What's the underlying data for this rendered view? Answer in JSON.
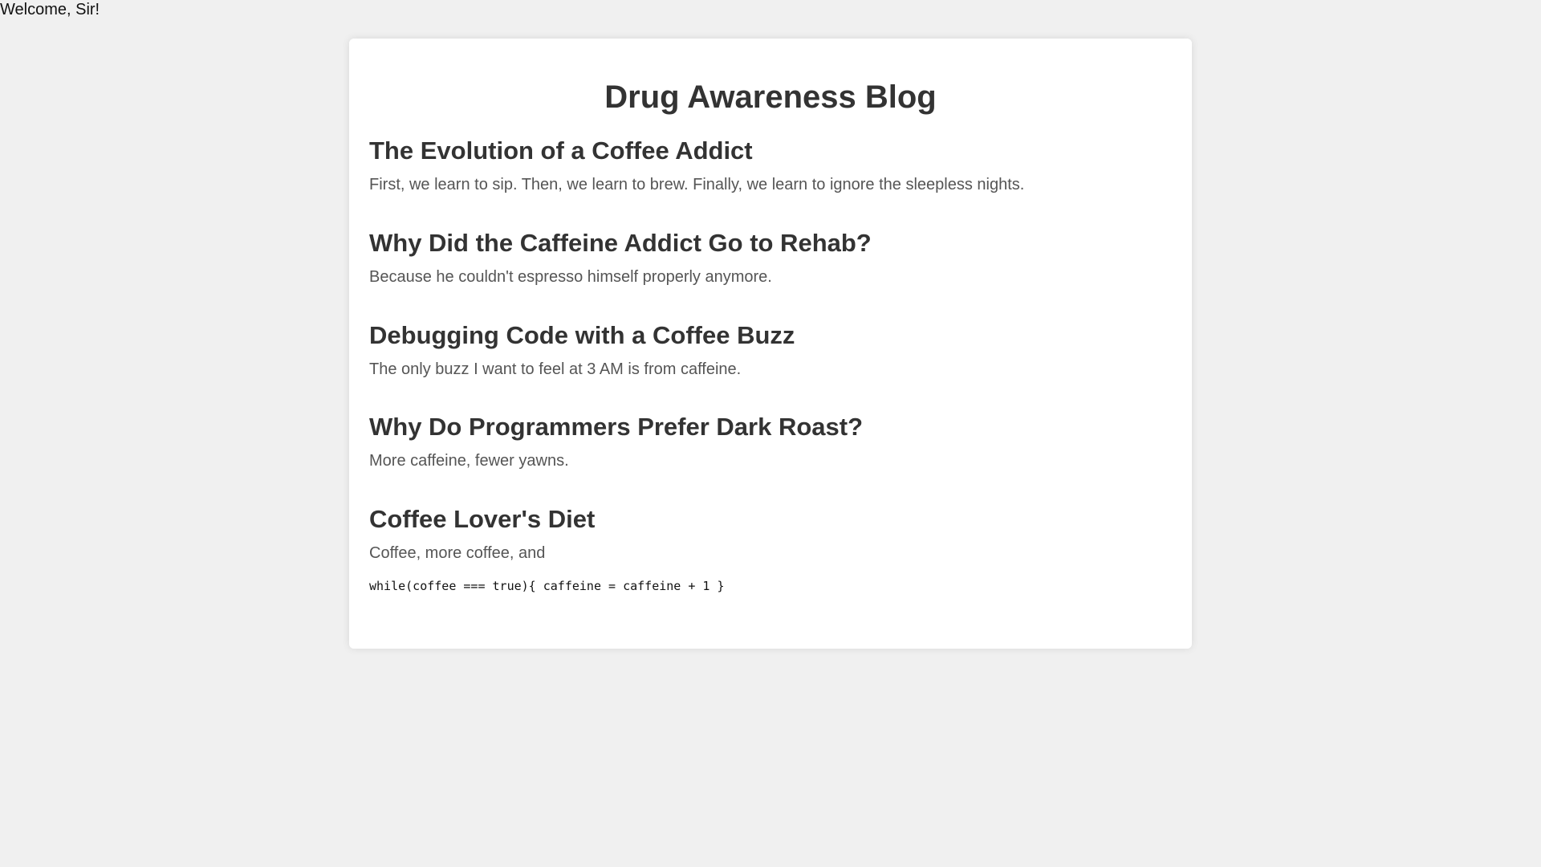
{
  "header": {
    "welcome": "Welcome, Sir!"
  },
  "blog": {
    "title": "Drug Awareness Blog",
    "posts": [
      {
        "title": "The Evolution of a Coffee Addict",
        "text": "First, we learn to sip. Then, we learn to brew. Finally, we learn to ignore the sleepless nights."
      },
      {
        "title": "Why Did the Caffeine Addict Go to Rehab?",
        "text": "Because he couldn't espresso himself properly anymore."
      },
      {
        "title": "Debugging Code with a Coffee Buzz",
        "text": "The only buzz I want to feel at 3 AM is from caffeine."
      },
      {
        "title": "Why Do Programmers Prefer Dark Roast?",
        "text": "More caffeine, fewer yawns."
      },
      {
        "title": "Coffee Lover's Diet",
        "text": "Coffee, more coffee, and",
        "code": "while(coffee === true){ caffeine = caffeine + 1 }"
      }
    ]
  },
  "colors": {
    "background": "#f0f0f0",
    "card": "#ffffff",
    "heading": "#333333",
    "body_text": "#555555"
  }
}
